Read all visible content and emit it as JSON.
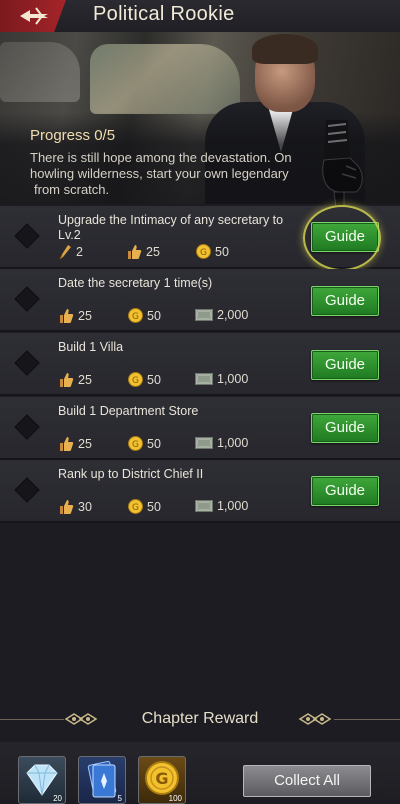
{
  "header": {
    "title": "Political Rookie",
    "back_icon": "back-arrow-icon"
  },
  "banner": {
    "progress": "Progress 0/5",
    "desc_line1": "There is still hope among the devastation. On",
    "desc_line2": "howling wilderness, start your own legendary",
    "desc_line3": "from scratch.",
    "pointer_icon": "pointing-glove-icon"
  },
  "tasks": [
    {
      "name": "Upgrade the Intimacy of any secretary to Lv.2",
      "rewards": [
        {
          "icon": "quill-icon",
          "value": "2"
        },
        {
          "icon": "thumbs-up-icon",
          "value": "25"
        },
        {
          "icon": "coin-icon",
          "value": "50"
        }
      ],
      "button": "Guide"
    },
    {
      "name": "Date the secretary 1 time(s)",
      "rewards": [
        {
          "icon": "thumbs-up-icon",
          "value": "25"
        },
        {
          "icon": "coin-icon",
          "value": "50"
        },
        {
          "icon": "cash-icon",
          "value": "2,000"
        }
      ],
      "button": "Guide"
    },
    {
      "name": "Build 1 Villa",
      "rewards": [
        {
          "icon": "thumbs-up-icon",
          "value": "25"
        },
        {
          "icon": "coin-icon",
          "value": "50"
        },
        {
          "icon": "cash-icon",
          "value": "1,000"
        }
      ],
      "button": "Guide"
    },
    {
      "name": "Build 1 Department Store",
      "rewards": [
        {
          "icon": "thumbs-up-icon",
          "value": "25"
        },
        {
          "icon": "coin-icon",
          "value": "50"
        },
        {
          "icon": "cash-icon",
          "value": "1,000"
        }
      ],
      "button": "Guide"
    },
    {
      "name": "Rank up to District Chief II",
      "rewards": [
        {
          "icon": "thumbs-up-icon",
          "value": "30"
        },
        {
          "icon": "coin-icon",
          "value": "50"
        },
        {
          "icon": "cash-icon",
          "value": "1,000"
        }
      ],
      "button": "Guide"
    }
  ],
  "chapter": {
    "title": "Chapter Reward",
    "items": [
      {
        "icon": "diamond-gem-icon",
        "count": "20"
      },
      {
        "icon": "blue-card-icon",
        "count": "5"
      },
      {
        "icon": "gold-coin-icon",
        "count": "100"
      }
    ],
    "collect_label": "Collect All"
  },
  "colors": {
    "accent_red": "#a52428",
    "button_green": "#2f8f2e",
    "collect_gray": "#777779"
  }
}
